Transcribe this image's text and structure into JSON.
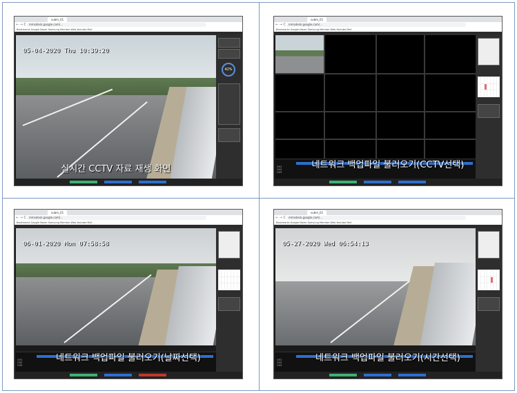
{
  "panels": [
    {
      "caption": "실시간 CCTV 자료 재생 화면",
      "osd": "05-04-2020 Thu 10:39:20",
      "tab_label": "subm_01",
      "url": "mmsdesk.google.com/...",
      "dial_value": "42%"
    },
    {
      "caption": "네트워크 백업파일 불러오기(CCTV선택)",
      "osd": "",
      "tab_label": "subm_01",
      "url": "mmsdesk.google.com/..."
    },
    {
      "caption": "네트워크 백업파일 불러오기(날짜선택)",
      "osd": "06-01-2020 Mon 07:58:58",
      "tab_label": "subm_01",
      "url": "mmsdesk.google.com/..."
    },
    {
      "caption": "네트워크 백업파일 불러오기(시간선택)",
      "osd": "05-27-2020 Wed 06:54:13",
      "tab_label": "subm_01",
      "url": "mmsdesk.google.com/..."
    }
  ],
  "bookmarks": "Bookmarks  Google  Naver  Samsung Member  Web  Youtube  Mail",
  "colors": {
    "border": "#7b99c1",
    "timeline": "#2d6fd1",
    "status_green": "#3cb371",
    "status_blue": "#2d6fd1",
    "status_red": "#c0392b"
  }
}
